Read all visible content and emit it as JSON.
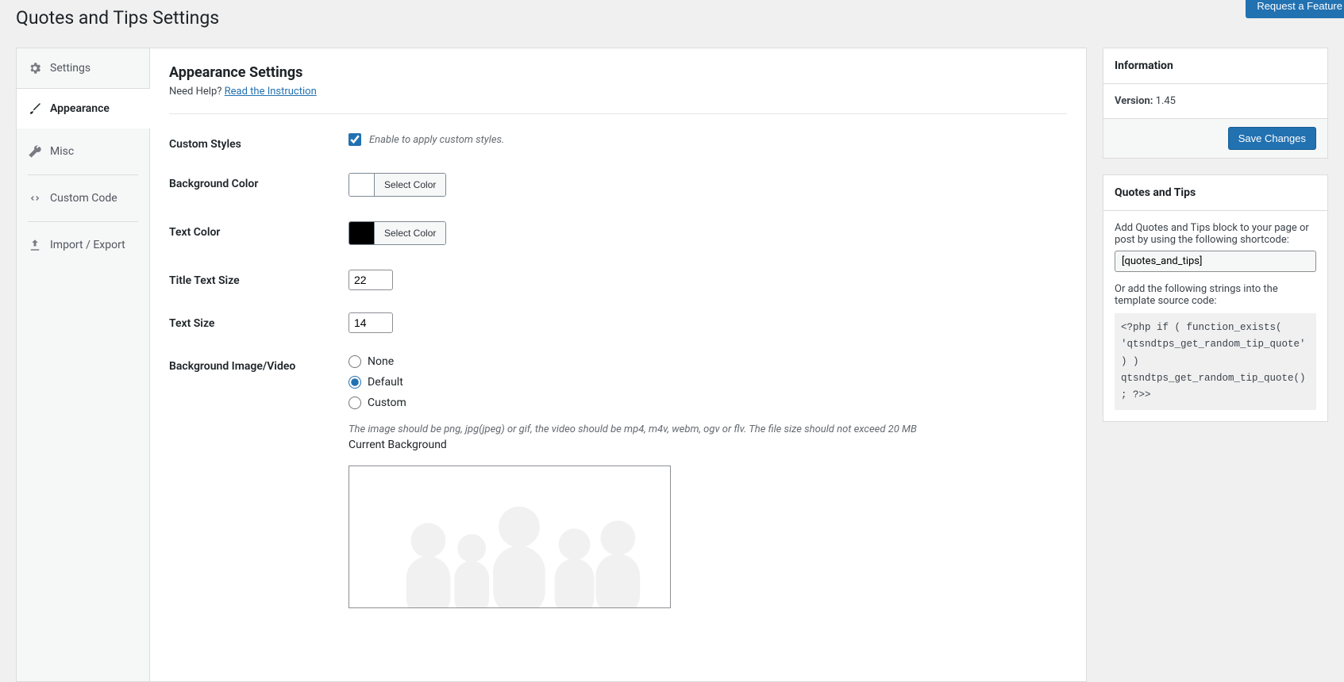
{
  "header": {
    "title": "Quotes and Tips Settings",
    "request_btn": "Request a Feature"
  },
  "tabs": {
    "settings": "Settings",
    "appearance": "Appearance",
    "misc": "Misc",
    "custom_code": "Custom Code",
    "import_export": "Import / Export"
  },
  "panel": {
    "heading": "Appearance Settings",
    "help_prefix": "Need Help? ",
    "help_link": "Read the Instruction",
    "rows": {
      "custom_styles_label": "Custom Styles",
      "custom_styles_desc": "Enable to apply custom styles.",
      "bg_color_label": "Background Color",
      "bg_color_btn": "Select Color",
      "bg_color_value": "#ffffff",
      "text_color_label": "Text Color",
      "text_color_btn": "Select Color",
      "text_color_value": "#000000",
      "title_size_label": "Title Text Size",
      "title_size_value": "22",
      "text_size_label": "Text Size",
      "text_size_value": "14",
      "bg_media_label": "Background Image/Video",
      "bg_opts": {
        "none": "None",
        "default": "Default",
        "custom": "Custom"
      },
      "bg_hint": "The image should be png, jpg(jpeg) or gif, the video should be mp4, m4v, webm, ogv or flv. The file size should not exceed 20 MB",
      "bg_current": "Current Background"
    }
  },
  "info_box": {
    "title": "Information",
    "version_label": "Version:",
    "version_value": "1.45",
    "save_btn": "Save Changes"
  },
  "qt_box": {
    "title": "Quotes and Tips",
    "intro": "Add Quotes and Tips block to your page or post by using the following shortcode:",
    "shortcode": "[quotes_and_tips]",
    "or_text": "Or add the following strings into the template source code:",
    "code": "<?php if ( function_exists( 'qtsndtps_get_random_tip_quote' ) ) qtsndtps_get_random_tip_quote(); ?>>"
  }
}
